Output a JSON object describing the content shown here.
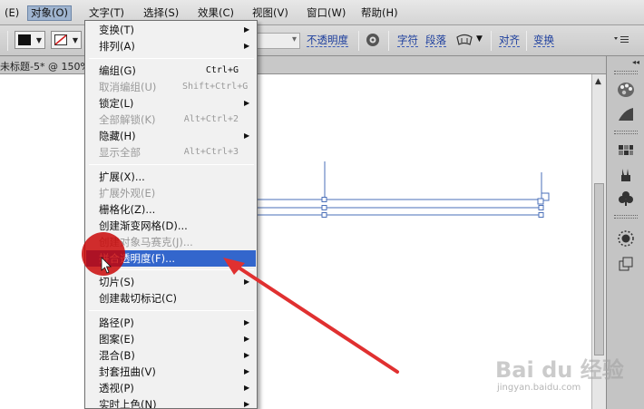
{
  "menubar": {
    "items": [
      {
        "label": "(E)"
      },
      {
        "label": "对象(O)"
      },
      {
        "label": "文字(T)"
      },
      {
        "label": "选择(S)"
      },
      {
        "label": "效果(C)"
      },
      {
        "label": "视图(V)"
      },
      {
        "label": "窗口(W)"
      },
      {
        "label": "帮助(H)"
      }
    ]
  },
  "controlbar": {
    "opacity_label": "不透明度",
    "char_label": "字符",
    "para_label": "段落",
    "align_label": "对齐",
    "transform_label": "变换"
  },
  "document": {
    "tab_label": "未标题-5* @ 150%"
  },
  "menu": {
    "items": [
      {
        "label": "变换(T)",
        "shortcut": "",
        "submenu": true
      },
      {
        "label": "排列(A)",
        "shortcut": "",
        "submenu": true
      },
      {
        "label": "编组(G)",
        "shortcut": "Ctrl+G",
        "submenu": false
      },
      {
        "label": "取消编组(U)",
        "shortcut": "Shift+Ctrl+G",
        "submenu": false
      },
      {
        "label": "锁定(L)",
        "shortcut": "",
        "submenu": true
      },
      {
        "label": "全部解锁(K)",
        "shortcut": "Alt+Ctrl+2",
        "submenu": false
      },
      {
        "label": "隐藏(H)",
        "shortcut": "",
        "submenu": true
      },
      {
        "label": "显示全部",
        "shortcut": "Alt+Ctrl+3",
        "submenu": false
      },
      {
        "label": "扩展(X)...",
        "shortcut": "",
        "submenu": false
      },
      {
        "label": "扩展外观(E)",
        "shortcut": "",
        "submenu": false
      },
      {
        "label": "栅格化(Z)...",
        "shortcut": "",
        "submenu": false
      },
      {
        "label": "创建渐变网格(D)...",
        "shortcut": "",
        "submenu": false
      },
      {
        "label": "创建对象马赛克(J)...",
        "shortcut": "",
        "submenu": false
      },
      {
        "label": "拼合透明度(F)...",
        "shortcut": "",
        "submenu": false
      },
      {
        "label": "切片(S)",
        "shortcut": "",
        "submenu": true
      },
      {
        "label": "创建裁切标记(C)",
        "shortcut": "",
        "submenu": false
      },
      {
        "label": "路径(P)",
        "shortcut": "",
        "submenu": true
      },
      {
        "label": "图案(E)",
        "shortcut": "",
        "submenu": true
      },
      {
        "label": "混合(B)",
        "shortcut": "",
        "submenu": true
      },
      {
        "label": "封套扭曲(V)",
        "shortcut": "",
        "submenu": true
      },
      {
        "label": "透视(P)",
        "shortcut": "",
        "submenu": true
      },
      {
        "label": "实时上色(N)",
        "shortcut": "",
        "submenu": true
      }
    ]
  },
  "watermark": {
    "brand": "Bai du 经验",
    "url": "jingyan.baidu.com"
  },
  "colors": {
    "highlight": "#3366cc",
    "annotation_red": "#e03030",
    "guide_blue": "#4a6fb8"
  },
  "icons": [
    "color-icon",
    "gradient-icon",
    "swatches-icon",
    "brushes-icon",
    "symbols-icon",
    "appearance-icon",
    "layers-icon",
    "globe-icon"
  ]
}
